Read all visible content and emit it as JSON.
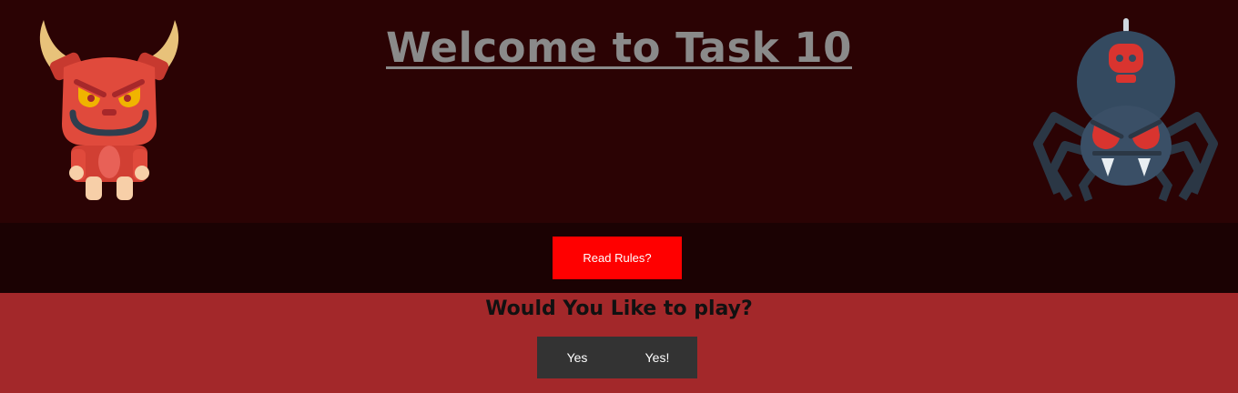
{
  "header": {
    "title": "Welcome to Task 10",
    "left_image_icon": "devil-icon",
    "right_image_icon": "spider-icon"
  },
  "rules": {
    "button_label": "Read Rules?"
  },
  "play": {
    "question": "Would You Like to play?",
    "yes_label": "Yes",
    "yes_excl_label": "Yes!"
  },
  "colors": {
    "header_bg": "#2b0304",
    "rules_band_bg": "#1b0203",
    "play_bg": "#a3282a",
    "rules_button": "#ff0000",
    "play_buttons": "#333333",
    "title_text": "#8a8a8a"
  }
}
